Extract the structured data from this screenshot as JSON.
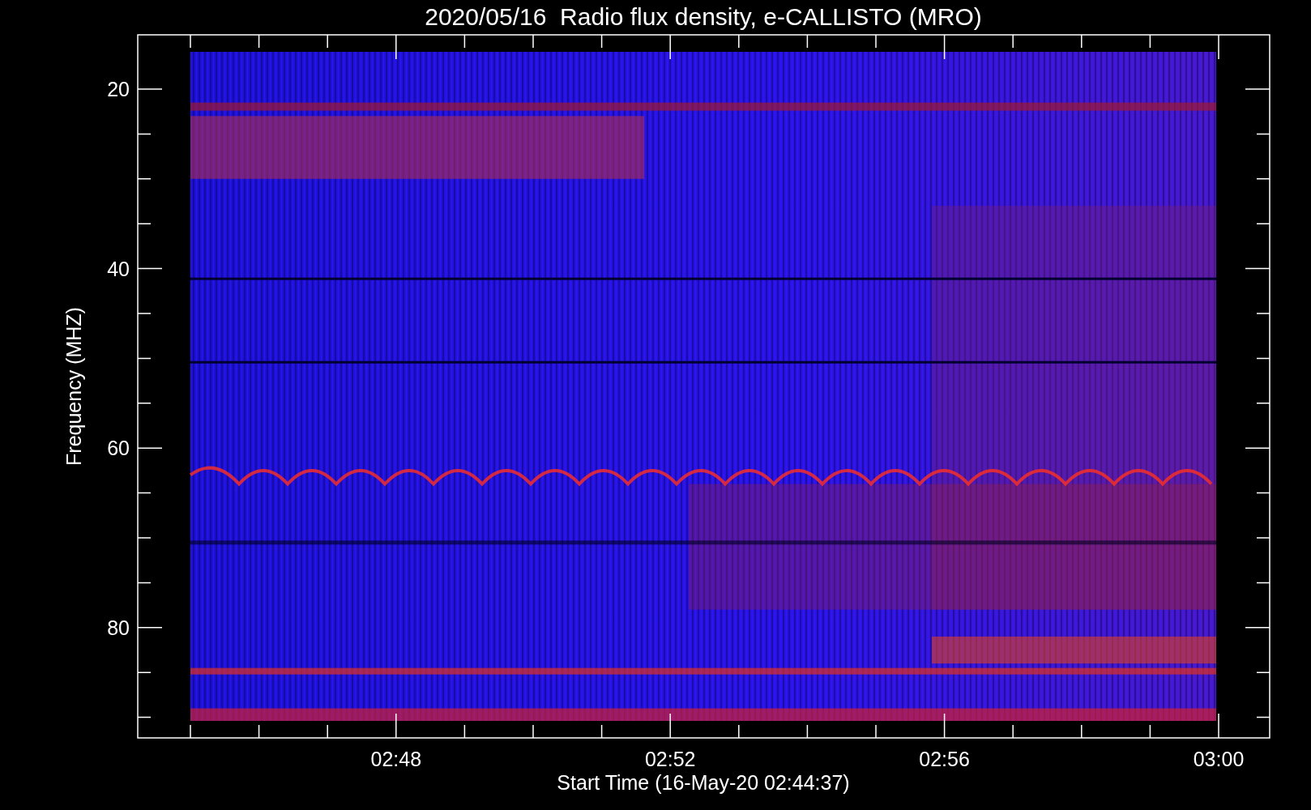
{
  "plot": {
    "title": "2020/05/16  Radio flux density, e-CALLISTO (MRO)",
    "x_axis": {
      "label": "Start Time (16-May-20 02:44:37)",
      "ticks": [
        "02:48",
        "02:52",
        "02:56",
        "03:00"
      ]
    },
    "y_axis": {
      "label": "Frequency (MHZ)",
      "ticks": [
        "20",
        "40",
        "60",
        "80"
      ]
    }
  }
}
